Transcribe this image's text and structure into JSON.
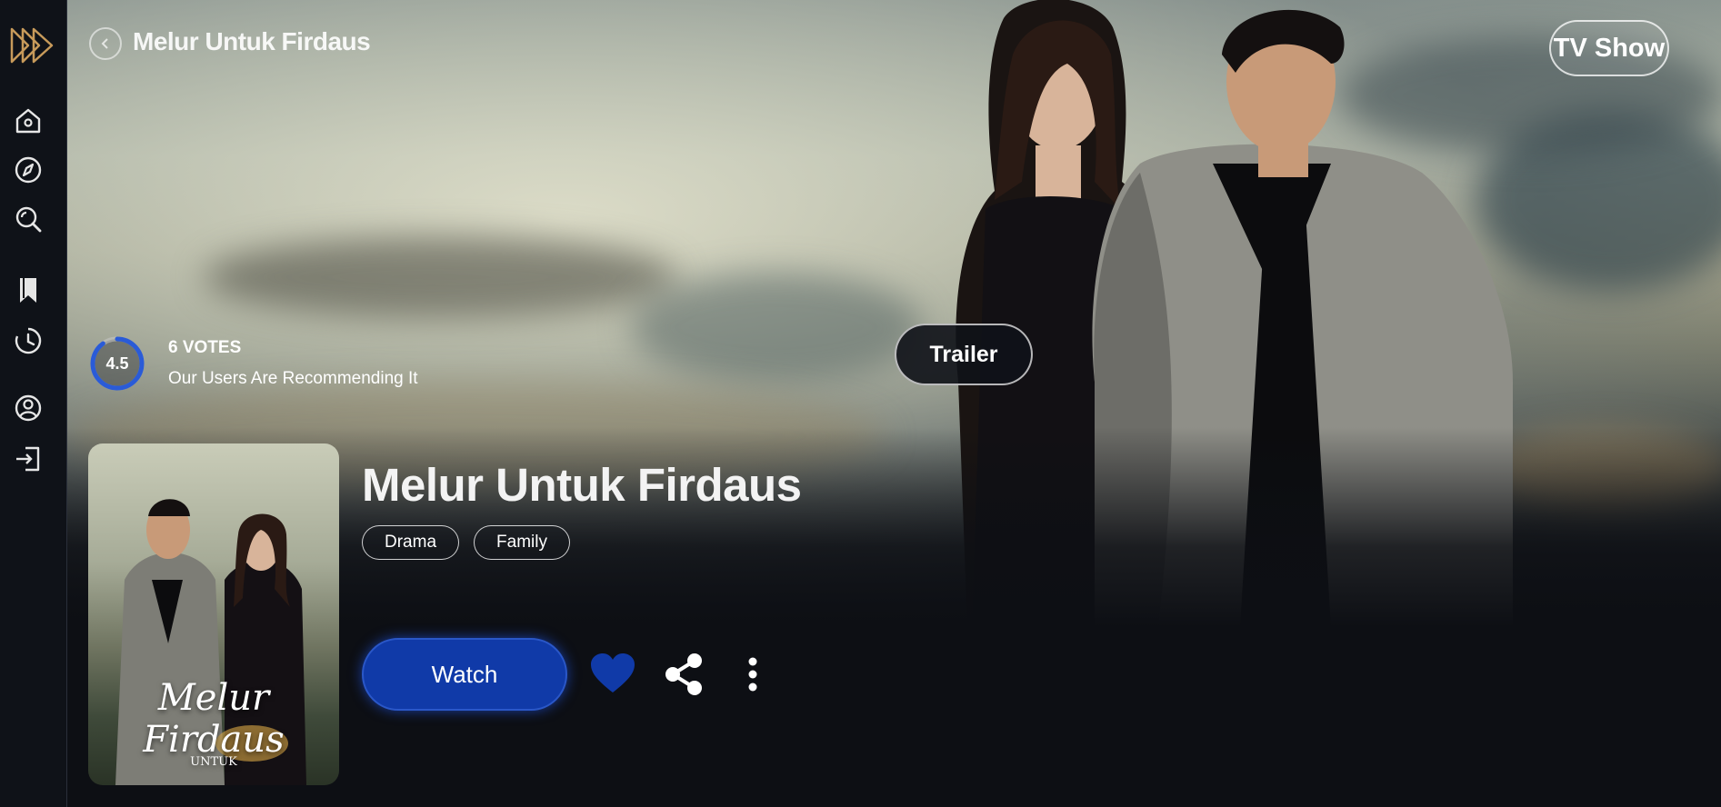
{
  "header": {
    "title": "Melur Untuk Firdaus",
    "badge": "TV Show"
  },
  "sidebar": {
    "logo_icon": "play-logo-icon",
    "items": [
      {
        "icon": "home-icon"
      },
      {
        "icon": "compass-icon"
      },
      {
        "icon": "search-icon"
      },
      {
        "icon": "bookmark-icon"
      },
      {
        "icon": "clock-icon"
      },
      {
        "icon": "user-icon"
      },
      {
        "icon": "login-icon"
      }
    ]
  },
  "rating": {
    "value": "4.5",
    "fraction": 0.9,
    "votes_text": "6 VOTES",
    "recommend_text": "Our Users Are Recommending It"
  },
  "trailer_label": "Trailer",
  "show": {
    "title": "Melur Untuk Firdaus",
    "genres": [
      "Drama",
      "Family"
    ],
    "poster_title": "Melur Firdaus",
    "poster_subtitle": "UNTUK"
  },
  "actions": {
    "watch_label": "Watch",
    "icons": [
      "heart-icon",
      "share-icon",
      "more-vertical-icon"
    ]
  },
  "colors": {
    "accent": "#103aa8",
    "logo": "#c79a5a",
    "background": "#0d0f14",
    "rating_ring": "#2a5bd7"
  }
}
